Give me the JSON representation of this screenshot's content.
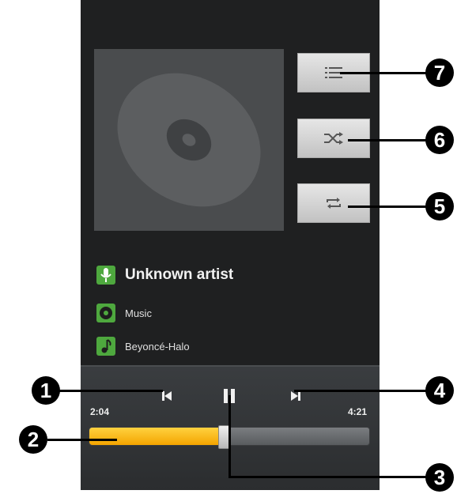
{
  "player": {
    "artist": "Unknown artist",
    "album": "Music",
    "track": "Beyoncé-Halo",
    "elapsed": "2:04",
    "duration": "4:21",
    "progress_fraction": 0.48
  },
  "buttons": {
    "playlist_icon": "playlist-icon",
    "shuffle_icon": "shuffle-icon",
    "repeat_icon": "repeat-icon",
    "previous_icon": "previous-icon",
    "pause_icon": "pause-icon",
    "next_icon": "next-icon"
  },
  "callouts": {
    "c1": "1",
    "c2": "2",
    "c3": "3",
    "c4": "4",
    "c5": "5",
    "c6": "6",
    "c7": "7"
  },
  "colors": {
    "accent": "#f4b400",
    "icon_green": "#4ea83e",
    "background": "#1f2021"
  }
}
